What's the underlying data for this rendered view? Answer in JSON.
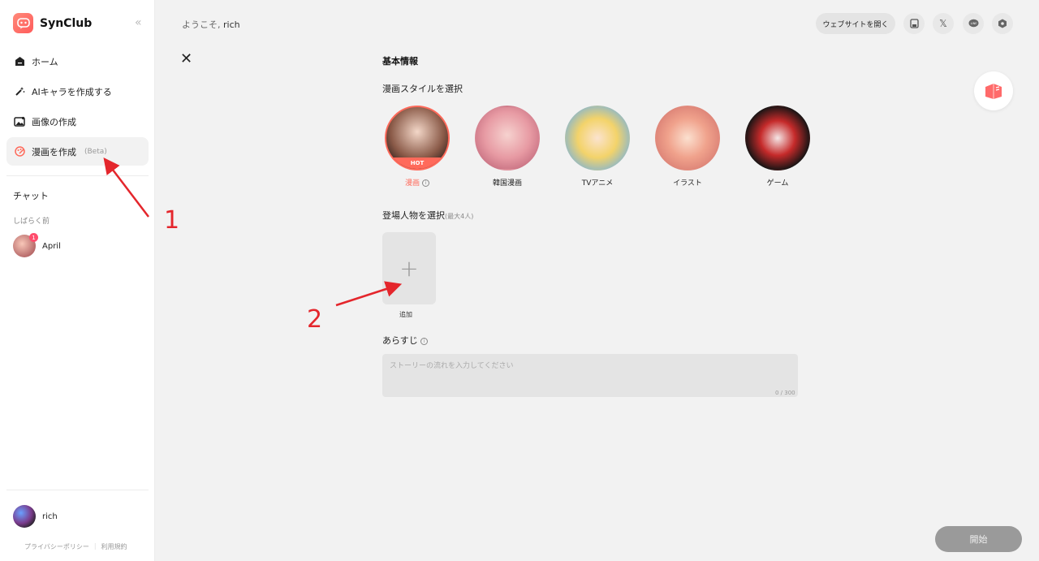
{
  "app": {
    "name": "SynClub"
  },
  "sidebar": {
    "items": [
      {
        "label": "ホーム",
        "icon": "home-icon"
      },
      {
        "label": "AIキャラを作成する",
        "icon": "magic-wand-icon"
      },
      {
        "label": "画像の作成",
        "icon": "image-icon"
      },
      {
        "label": "漫画を作成",
        "beta": "(Beta)",
        "icon": "palette-icon"
      }
    ],
    "chat_title": "チャット",
    "chat_recent": "しばらく前",
    "chat_name": "April",
    "chat_badge": "1",
    "user_name": "rich",
    "privacy": "プライバシーポリシー",
    "terms": "利用規約"
  },
  "header": {
    "welcome": "ようこそ,",
    "user": "rich",
    "site_button": "ウェブサイトを開く"
  },
  "form": {
    "basic_info": "基本情報",
    "style_label": "漫画スタイルを選択",
    "styles": [
      {
        "name": "漫画",
        "hot": "HOT"
      },
      {
        "name": "韓国漫画"
      },
      {
        "name": "TVアニメ"
      },
      {
        "name": "イラスト"
      },
      {
        "name": "ゲーム"
      }
    ],
    "character_label": "登場人物を選択",
    "character_hint": "(最大4人)",
    "add_label": "追加",
    "plot_label": "あらすじ",
    "plot_placeholder": "ストーリーの流れを入力してください",
    "plot_count": "0 / 300",
    "start": "開始"
  },
  "annotations": [
    "1",
    "2"
  ],
  "colors": {
    "accent": "#ff6a5b",
    "annotation": "#e4262c"
  }
}
